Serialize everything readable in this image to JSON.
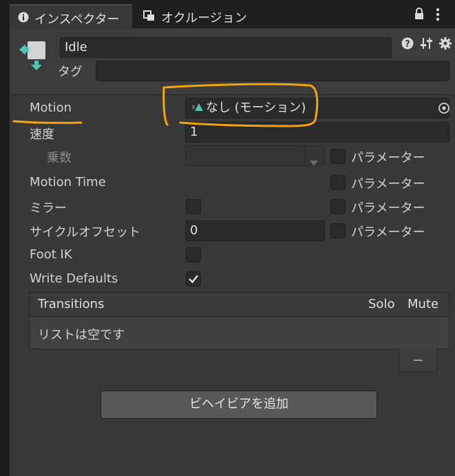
{
  "tabs": [
    {
      "label": "インスペクター",
      "icon": "info-icon"
    },
    {
      "label": "オクルージョン",
      "icon": "occlusion-icon"
    }
  ],
  "header": {
    "name_value": "Idle",
    "tag_label": "タグ",
    "tag_value": ""
  },
  "properties": {
    "motion_label": "Motion",
    "motion_value": "なし (モーション)",
    "speed_label": "速度",
    "speed_value": "1",
    "multiplier_label": "乗数",
    "multiplier_value": "",
    "motion_time_label": "Motion Time",
    "mirror_label": "ミラー",
    "cycle_offset_label": "サイクルオフセット",
    "cycle_offset_value": "0",
    "foot_ik_label": "Foot IK",
    "write_defaults_label": "Write Defaults",
    "parameter_label": "パラメーター",
    "mirror_checked": false,
    "foot_ik_checked": false,
    "write_defaults_checked": true
  },
  "transitions": {
    "title": "Transitions",
    "solo_label": "Solo",
    "mute_label": "Mute",
    "empty_text": "リストは空です",
    "remove_label": "−"
  },
  "add_behaviour_label": "ビヘイビアを追加",
  "colors": {
    "annotation": "#f6a30c",
    "accent": "#4fc3b4"
  }
}
